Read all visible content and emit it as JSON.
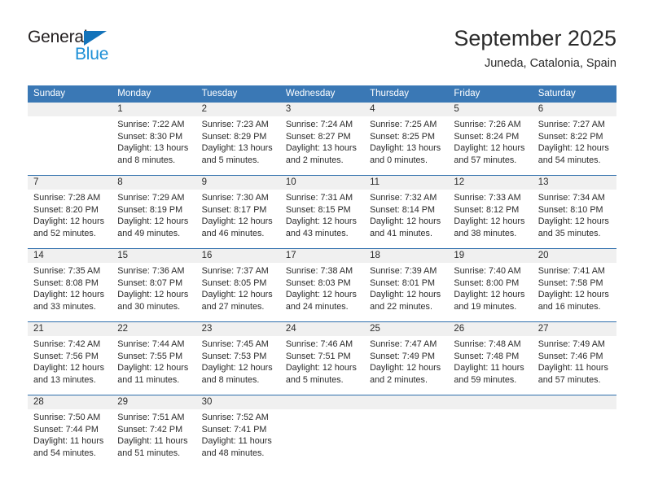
{
  "brand": {
    "name_top": "General",
    "name_bottom": "Blue",
    "accent_color": "#1d8fd6",
    "triangle_color": "#1373ba"
  },
  "header": {
    "title": "September 2025",
    "subtitle": "Juneda, Catalonia, Spain"
  },
  "theme": {
    "header_bar_color": "#3a78b5",
    "row_separator_color": "#2f6fac",
    "date_band_color": "#f0f0f0",
    "text_color": "#2b2b2b"
  },
  "calendar": {
    "weekdays": [
      "Sunday",
      "Monday",
      "Tuesday",
      "Wednesday",
      "Thursday",
      "Friday",
      "Saturday"
    ],
    "weeks": [
      [
        {
          "day": "",
          "lines": []
        },
        {
          "day": "1",
          "lines": [
            "Sunrise: 7:22 AM",
            "Sunset: 8:30 PM",
            "Daylight: 13 hours",
            "and 8 minutes."
          ]
        },
        {
          "day": "2",
          "lines": [
            "Sunrise: 7:23 AM",
            "Sunset: 8:29 PM",
            "Daylight: 13 hours",
            "and 5 minutes."
          ]
        },
        {
          "day": "3",
          "lines": [
            "Sunrise: 7:24 AM",
            "Sunset: 8:27 PM",
            "Daylight: 13 hours",
            "and 2 minutes."
          ]
        },
        {
          "day": "4",
          "lines": [
            "Sunrise: 7:25 AM",
            "Sunset: 8:25 PM",
            "Daylight: 13 hours",
            "and 0 minutes."
          ]
        },
        {
          "day": "5",
          "lines": [
            "Sunrise: 7:26 AM",
            "Sunset: 8:24 PM",
            "Daylight: 12 hours",
            "and 57 minutes."
          ]
        },
        {
          "day": "6",
          "lines": [
            "Sunrise: 7:27 AM",
            "Sunset: 8:22 PM",
            "Daylight: 12 hours",
            "and 54 minutes."
          ]
        }
      ],
      [
        {
          "day": "7",
          "lines": [
            "Sunrise: 7:28 AM",
            "Sunset: 8:20 PM",
            "Daylight: 12 hours",
            "and 52 minutes."
          ]
        },
        {
          "day": "8",
          "lines": [
            "Sunrise: 7:29 AM",
            "Sunset: 8:19 PM",
            "Daylight: 12 hours",
            "and 49 minutes."
          ]
        },
        {
          "day": "9",
          "lines": [
            "Sunrise: 7:30 AM",
            "Sunset: 8:17 PM",
            "Daylight: 12 hours",
            "and 46 minutes."
          ]
        },
        {
          "day": "10",
          "lines": [
            "Sunrise: 7:31 AM",
            "Sunset: 8:15 PM",
            "Daylight: 12 hours",
            "and 43 minutes."
          ]
        },
        {
          "day": "11",
          "lines": [
            "Sunrise: 7:32 AM",
            "Sunset: 8:14 PM",
            "Daylight: 12 hours",
            "and 41 minutes."
          ]
        },
        {
          "day": "12",
          "lines": [
            "Sunrise: 7:33 AM",
            "Sunset: 8:12 PM",
            "Daylight: 12 hours",
            "and 38 minutes."
          ]
        },
        {
          "day": "13",
          "lines": [
            "Sunrise: 7:34 AM",
            "Sunset: 8:10 PM",
            "Daylight: 12 hours",
            "and 35 minutes."
          ]
        }
      ],
      [
        {
          "day": "14",
          "lines": [
            "Sunrise: 7:35 AM",
            "Sunset: 8:08 PM",
            "Daylight: 12 hours",
            "and 33 minutes."
          ]
        },
        {
          "day": "15",
          "lines": [
            "Sunrise: 7:36 AM",
            "Sunset: 8:07 PM",
            "Daylight: 12 hours",
            "and 30 minutes."
          ]
        },
        {
          "day": "16",
          "lines": [
            "Sunrise: 7:37 AM",
            "Sunset: 8:05 PM",
            "Daylight: 12 hours",
            "and 27 minutes."
          ]
        },
        {
          "day": "17",
          "lines": [
            "Sunrise: 7:38 AM",
            "Sunset: 8:03 PM",
            "Daylight: 12 hours",
            "and 24 minutes."
          ]
        },
        {
          "day": "18",
          "lines": [
            "Sunrise: 7:39 AM",
            "Sunset: 8:01 PM",
            "Daylight: 12 hours",
            "and 22 minutes."
          ]
        },
        {
          "day": "19",
          "lines": [
            "Sunrise: 7:40 AM",
            "Sunset: 8:00 PM",
            "Daylight: 12 hours",
            "and 19 minutes."
          ]
        },
        {
          "day": "20",
          "lines": [
            "Sunrise: 7:41 AM",
            "Sunset: 7:58 PM",
            "Daylight: 12 hours",
            "and 16 minutes."
          ]
        }
      ],
      [
        {
          "day": "21",
          "lines": [
            "Sunrise: 7:42 AM",
            "Sunset: 7:56 PM",
            "Daylight: 12 hours",
            "and 13 minutes."
          ]
        },
        {
          "day": "22",
          "lines": [
            "Sunrise: 7:44 AM",
            "Sunset: 7:55 PM",
            "Daylight: 12 hours",
            "and 11 minutes."
          ]
        },
        {
          "day": "23",
          "lines": [
            "Sunrise: 7:45 AM",
            "Sunset: 7:53 PM",
            "Daylight: 12 hours",
            "and 8 minutes."
          ]
        },
        {
          "day": "24",
          "lines": [
            "Sunrise: 7:46 AM",
            "Sunset: 7:51 PM",
            "Daylight: 12 hours",
            "and 5 minutes."
          ]
        },
        {
          "day": "25",
          "lines": [
            "Sunrise: 7:47 AM",
            "Sunset: 7:49 PM",
            "Daylight: 12 hours",
            "and 2 minutes."
          ]
        },
        {
          "day": "26",
          "lines": [
            "Sunrise: 7:48 AM",
            "Sunset: 7:48 PM",
            "Daylight: 11 hours",
            "and 59 minutes."
          ]
        },
        {
          "day": "27",
          "lines": [
            "Sunrise: 7:49 AM",
            "Sunset: 7:46 PM",
            "Daylight: 11 hours",
            "and 57 minutes."
          ]
        }
      ],
      [
        {
          "day": "28",
          "lines": [
            "Sunrise: 7:50 AM",
            "Sunset: 7:44 PM",
            "Daylight: 11 hours",
            "and 54 minutes."
          ]
        },
        {
          "day": "29",
          "lines": [
            "Sunrise: 7:51 AM",
            "Sunset: 7:42 PM",
            "Daylight: 11 hours",
            "and 51 minutes."
          ]
        },
        {
          "day": "30",
          "lines": [
            "Sunrise: 7:52 AM",
            "Sunset: 7:41 PM",
            "Daylight: 11 hours",
            "and 48 minutes."
          ]
        },
        {
          "day": "",
          "lines": []
        },
        {
          "day": "",
          "lines": []
        },
        {
          "day": "",
          "lines": []
        },
        {
          "day": "",
          "lines": []
        }
      ]
    ]
  }
}
